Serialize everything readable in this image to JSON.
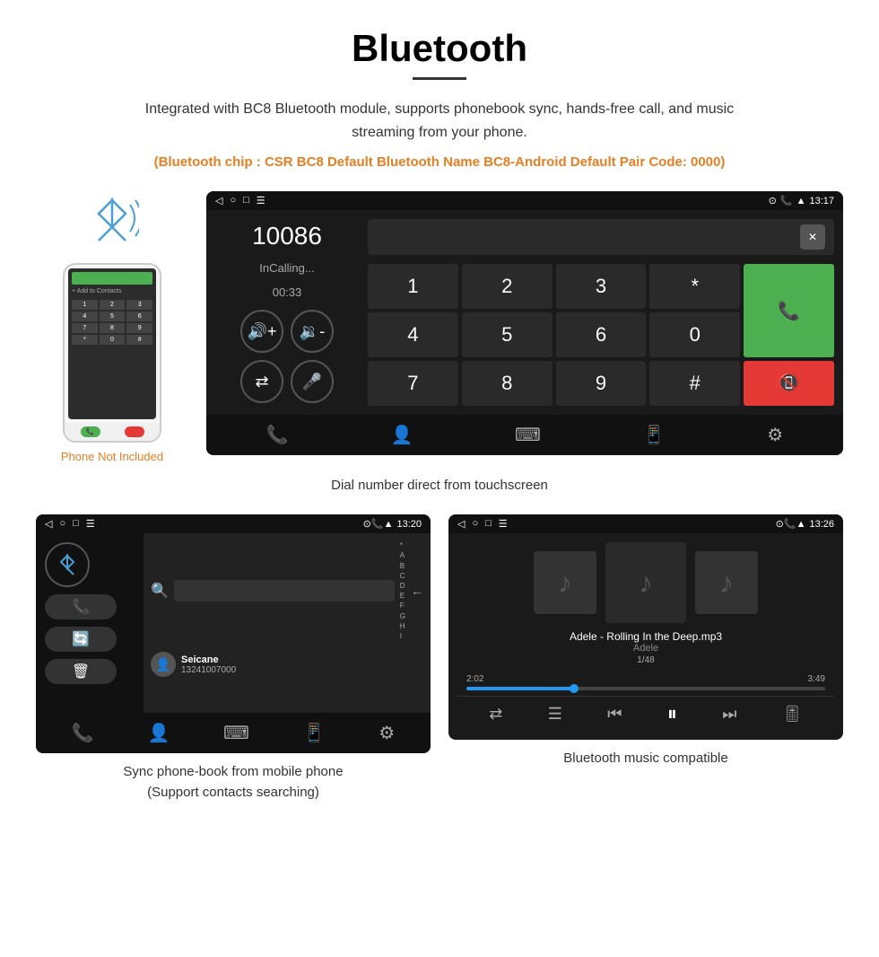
{
  "page": {
    "title": "Bluetooth",
    "description": "Integrated with BC8 Bluetooth module, supports phonebook sync, hands-free call, and music streaming from your phone.",
    "bluetooth_info": "(Bluetooth chip : CSR BC8    Default Bluetooth Name BC8-Android    Default Pair Code: 0000)",
    "phone_not_included": "Phone Not Included",
    "dial_caption": "Dial number direct from touchscreen",
    "contacts_caption": "Sync phone-book from mobile phone\n(Support contacts searching)",
    "music_caption": "Bluetooth music compatible"
  },
  "dial_screen": {
    "status_left": [
      "◁",
      "○",
      "□",
      "☰"
    ],
    "status_right": "13:17",
    "dial_number": "10086",
    "in_calling": "InCalling...",
    "timer": "00:33",
    "vol_up": "◀+",
    "vol_down": "◀-",
    "switch": "⇄",
    "mic": "🎤",
    "keys": [
      "1",
      "2",
      "3",
      "*",
      "4",
      "5",
      "6",
      "0",
      "7",
      "8",
      "9",
      "#"
    ],
    "call_green": "📞",
    "call_red": "📞"
  },
  "contacts_screen": {
    "status_right": "13:20",
    "contact_name": "Seicane",
    "contact_number": "13241007000",
    "alpha": [
      "*",
      "A",
      "B",
      "C",
      "D",
      "E",
      "F",
      "G",
      "H",
      "I"
    ]
  },
  "music_screen": {
    "status_right": "13:26",
    "song": "Adele - Rolling In the Deep.mp3",
    "artist": "Adele",
    "track": "1/48",
    "time_current": "2:02",
    "time_total": "3:49"
  }
}
